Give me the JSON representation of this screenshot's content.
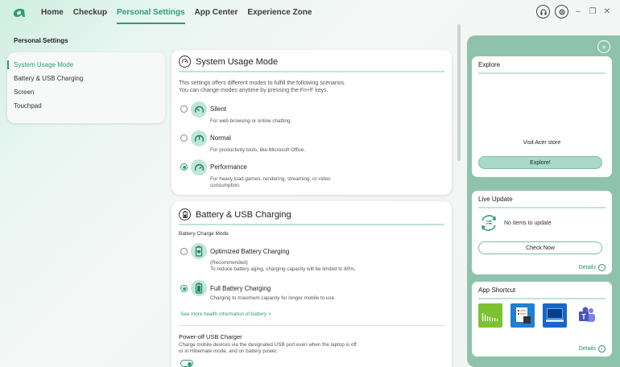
{
  "nav": {
    "items": [
      "Home",
      "Checkup",
      "Personal Settings",
      "App Center",
      "Experience Zone"
    ],
    "active": "Personal Settings"
  },
  "sidebar": {
    "title": "Personal Settings",
    "items": [
      "System Usage Mode",
      "Battery & USB Charging",
      "Screen",
      "Touchpad"
    ],
    "active": "System Usage Mode"
  },
  "usage_mode": {
    "title": "System Usage Mode",
    "description_1": "This settings offers different modes to fulfill the following scenarios.",
    "description_2": "You can change modes anytime by pressing the Fn+F keys.",
    "options": [
      {
        "label": "Silent",
        "desc": "For web browsing or online chatting.",
        "selected": false
      },
      {
        "label": "Normal",
        "desc": "For productivity tools, like Microsoft Office.",
        "selected": false
      },
      {
        "label": "Performance",
        "desc_1": "For heavy load games, rendering, streaming, or video",
        "desc_2": "consumption.",
        "selected": true
      }
    ]
  },
  "battery": {
    "title": "Battery & USB Charging",
    "section_label": "Battery Charge Mode",
    "options": [
      {
        "label": "Optimized Battery Charging",
        "sub": "(Recommended)",
        "desc": "To reduce battery aging, charging capacity will be limited to 80%.",
        "selected": false
      },
      {
        "label": "Full Battery Charging",
        "desc": "Charging to maximum capacity for longer mobile to use.",
        "selected": true
      }
    ],
    "link": "See more health information of battery >",
    "usb_title": "Power-off USB Charger",
    "usb_desc_1": "Charge mobile devices via the designated USB port even when the laptop is off",
    "usb_desc_2": "or in Hibernate mode, and on battery power.",
    "usb_toggle_on": true
  },
  "right": {
    "explore": {
      "title": "Explore",
      "store_text": "Visit Acer store",
      "button": "Explore!"
    },
    "live_update": {
      "title": "Live Update",
      "status": "No items to update",
      "button": "Check Now",
      "details": "Details"
    },
    "app_shortcut": {
      "title": "App Shortcut",
      "details": "Details",
      "apps": [
        "audio-app-icon",
        "notes-app-icon",
        "store-app-icon",
        "teams-app-icon"
      ]
    }
  },
  "colors": {
    "accent": "#2e9c74",
    "panel": "#8fc2ad"
  }
}
